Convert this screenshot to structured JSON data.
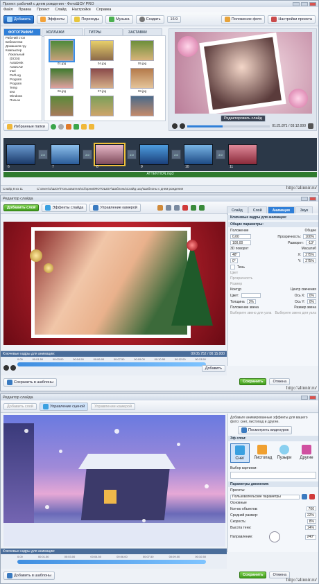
{
  "w1": {
    "title": "Проект: рабочий с днем рождения - ФотоШОУ PRO",
    "menu": [
      "Файл",
      "Правка",
      "Проект",
      "Слайд",
      "Настройки",
      "Справка"
    ],
    "toolbar": {
      "add": "Добавить",
      "effects": "Эффекты",
      "transitions": "Переходы",
      "music": "Музыка",
      "create": "Создать",
      "ratio": "16:9",
      "photo_pos": "Положение фото",
      "settings": "Настройки проекта"
    },
    "tabs": [
      "ФОТОГРАФИИ",
      "КОЛЛАЖИ",
      "ТИТРЫ",
      "ЗАСТАВКИ"
    ],
    "tree": [
      "Рабочий стол",
      "Библиотеки",
      "Домашняя гру",
      "Компьютер",
      "Локальный",
      "(DC04)",
      "AutoDesk",
      "AutoCAD",
      "Intel",
      "PerfLog",
      "Program",
      "Program",
      "Temp",
      "test",
      "Windows",
      "Пользо"
    ],
    "thumbs": [
      "01.jpg",
      "04.jpg",
      "05.jpg",
      "06.jpg",
      "07.jpg",
      "08.jpg",
      "",
      "",
      ""
    ],
    "fav": "Избранные папки",
    "preview": {
      "edit": "Редактировать слайд",
      "time": "01:21.871 / 03:12.000"
    },
    "slides": [
      {
        "num": "6",
        "dur": "15.0"
      },
      {
        "num": "7",
        "dur": "15.0"
      },
      {
        "num": "8",
        "dur": "15.0"
      },
      {
        "num": "9",
        "dur": "15.0"
      },
      {
        "num": "10",
        "dur": "15.0"
      },
      {
        "num": "11",
        "dur": ""
      }
    ],
    "transitions": [
      "2.0",
      "2.0",
      "2.0",
      "2.0",
      "2.0"
    ],
    "audio": "ATTENTION.mp3",
    "status": [
      "Слайд 8 из 11",
      "C:\\Users\\1\\ШОУ\\Пользователи\\Сборник\\ФОТОШОУ\\Шаблоны\\Слайд шоу\\Шаблоны с днем рождения"
    ]
  },
  "w2": {
    "title": "Редактор слайда",
    "toolbar": {
      "add_layer": "Добавить слой",
      "slide_effects": "Эффекты слайда",
      "camera": "Управление камерой"
    },
    "tabs": [
      "Слайд",
      "Слой",
      "Анимация",
      "Звук"
    ],
    "keyframes_label": "Ключевые кадры для анимации:",
    "general": "Общие параметры:",
    "pos_label": "Положение",
    "general2": "Общие",
    "x": "0,00",
    "y": "100,00",
    "opacity": "100%",
    "rotate": "-13°",
    "rot3d": "3D поворот",
    "scale": "Масштаб",
    "angle1": "48°",
    "angle2": "0°",
    "sx": "275%",
    "sy": "275%",
    "shadow": "Тень",
    "color": "Цвет",
    "opacity2": "Прозрачность",
    "size": "Размер",
    "contour": "Контур",
    "shadow_center": "Центр свечения",
    "color2": "Цвет:",
    "thickness": "Толщина",
    "thick_val": "3%",
    "ax": "0%",
    "ay": "0%",
    "pos_sub": "Положение звена",
    "size_sub": "Размер звена",
    "pick1": "Выберите звено для узла",
    "pick2": "Выберите звено для узла",
    "keyframes_bar": "Ключевые кадры для анимации:",
    "time": "00:05.752 / 00:15.000",
    "ticks": [
      "0.00",
      "00:01.50",
      "00:03.00",
      "00:04.50",
      "00:06.00",
      "00:07.50",
      "00:09.00",
      "00:10.50",
      "00:12.00",
      "00:13.50"
    ],
    "add": "Добавить",
    "save_tpl": "Сохранить в шаблоны",
    "save": "Сохранить",
    "cancel": "Отмена",
    "watermark": "http://alinnir.ru/"
  },
  "w3": {
    "title": "Редактор слайда",
    "toolbar": {
      "add_layer": "Добавить слой",
      "scene": "Управление сценой",
      "camera": "Управление камерой"
    },
    "hint": "Добавьте анимированные эффекты для вашего фото: снег, листопад и другие.",
    "video": "Посмотреть видеоурок",
    "effect_label": "Эф слои:",
    "effects": [
      "Снег",
      "Листопад",
      "Пузыри",
      "Другие"
    ],
    "pick": "Выбор картинки:",
    "params": "Параметры движения:",
    "preset_label": "Пресеты:",
    "preset": "Пользовательские параметры",
    "main": "Основные",
    "count": "Кол-во объектов:",
    "count_val": "700",
    "avg": "Средний размер:",
    "avg_val": "22%",
    "speed": "Скорость:",
    "speed_val": "8%",
    "opacity": "Высота тени:",
    "opacity_val": "14%",
    "angle": "Направление:",
    "angle_val": "240°",
    "keyframes_bar": "Ключевые кадры для анимации:",
    "ticks": [
      "0.00",
      "00:01.50",
      "00:03.00",
      "00:04.50",
      "00:06.00",
      "00:07.50",
      "00:09.00",
      "00:10.50"
    ],
    "save_tpl": "Добавить в шаблоны",
    "save": "Сохранить",
    "cancel": "Отмена",
    "watermark": "http://alinnir.ru/"
  },
  "colors": {
    "accent": "#2f7fd8",
    "green": "#3f9a1d",
    "red": "#c0182c",
    "night": "#3a4a9a"
  }
}
